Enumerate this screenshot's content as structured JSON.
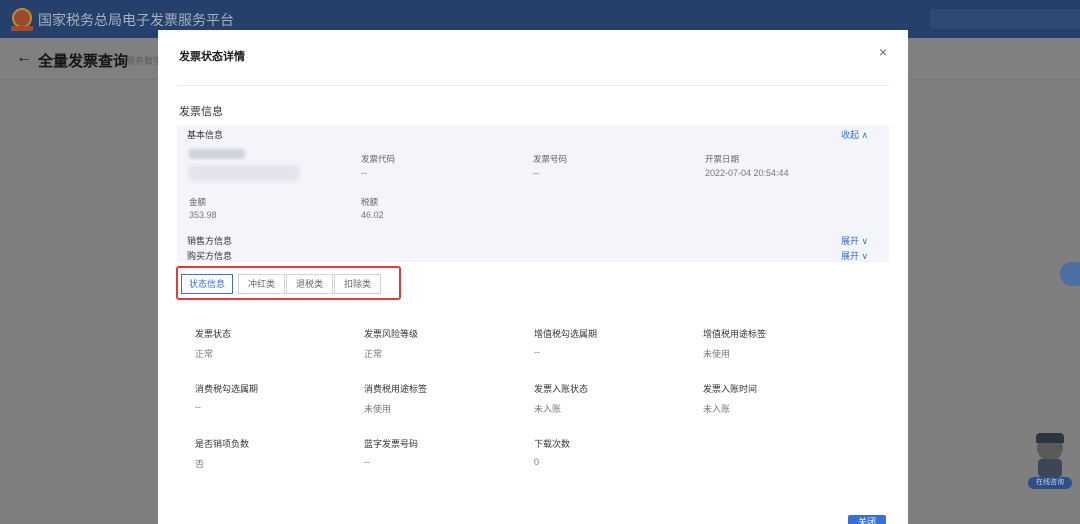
{
  "app": {
    "title": "国家税务总局电子发票服务平台",
    "back_icon": "←",
    "page_title": "全量发票查询",
    "crumb": "税务数字"
  },
  "modal": {
    "title": "发票状态详情",
    "close_icon": "×",
    "section_title": "发票信息",
    "basic": {
      "title": "基本信息",
      "collapse": "收起 ∧",
      "fields": {
        "invoice_code_label": "发票代码",
        "invoice_code_value": "--",
        "invoice_number_label": "发票号码",
        "invoice_number_value": "--",
        "issue_date_label": "开票日期",
        "issue_date_value": "2022-07-04 20:54:44",
        "amount_label": "金额",
        "amount_value": "353.98",
        "tax_label": "税额",
        "tax_value": "46.02"
      },
      "seller": "销售方信息",
      "buyer": "购买方信息",
      "expand": "展开 ∨"
    },
    "tabs": [
      "状态信息",
      "冲红类",
      "退税类",
      "扣除类"
    ],
    "status": {
      "invoice_status_label": "发票状态",
      "invoice_status_value": "正常",
      "risk_level_label": "发票风险等级",
      "risk_level_value": "正常",
      "vat_period_label": "增值税勾选属期",
      "vat_period_value": "--",
      "vat_usage_label": "增值税用途标签",
      "vat_usage_value": "未使用",
      "consumption_period_label": "消费税勾选属期",
      "consumption_period_value": "--",
      "consumption_usage_label": "消费税用途标签",
      "consumption_usage_value": "未使用",
      "entry_status_label": "发票入账状态",
      "entry_status_value": "未入账",
      "entry_time_label": "发票入账时间",
      "entry_time_value": "未入账",
      "negative_label": "是否销项负数",
      "negative_value": "否",
      "blue_invoice_label": "蓝字发票号码",
      "blue_invoice_value": "--",
      "download_label": "下载次数",
      "download_value": "0"
    },
    "close_button": "关闭"
  },
  "assistant_label": "在线咨询",
  "colors": {
    "primary": "#3a6fd8",
    "highlight": "#e23b3b",
    "topbar": "#24406b",
    "panel": "#f3f5fb"
  }
}
